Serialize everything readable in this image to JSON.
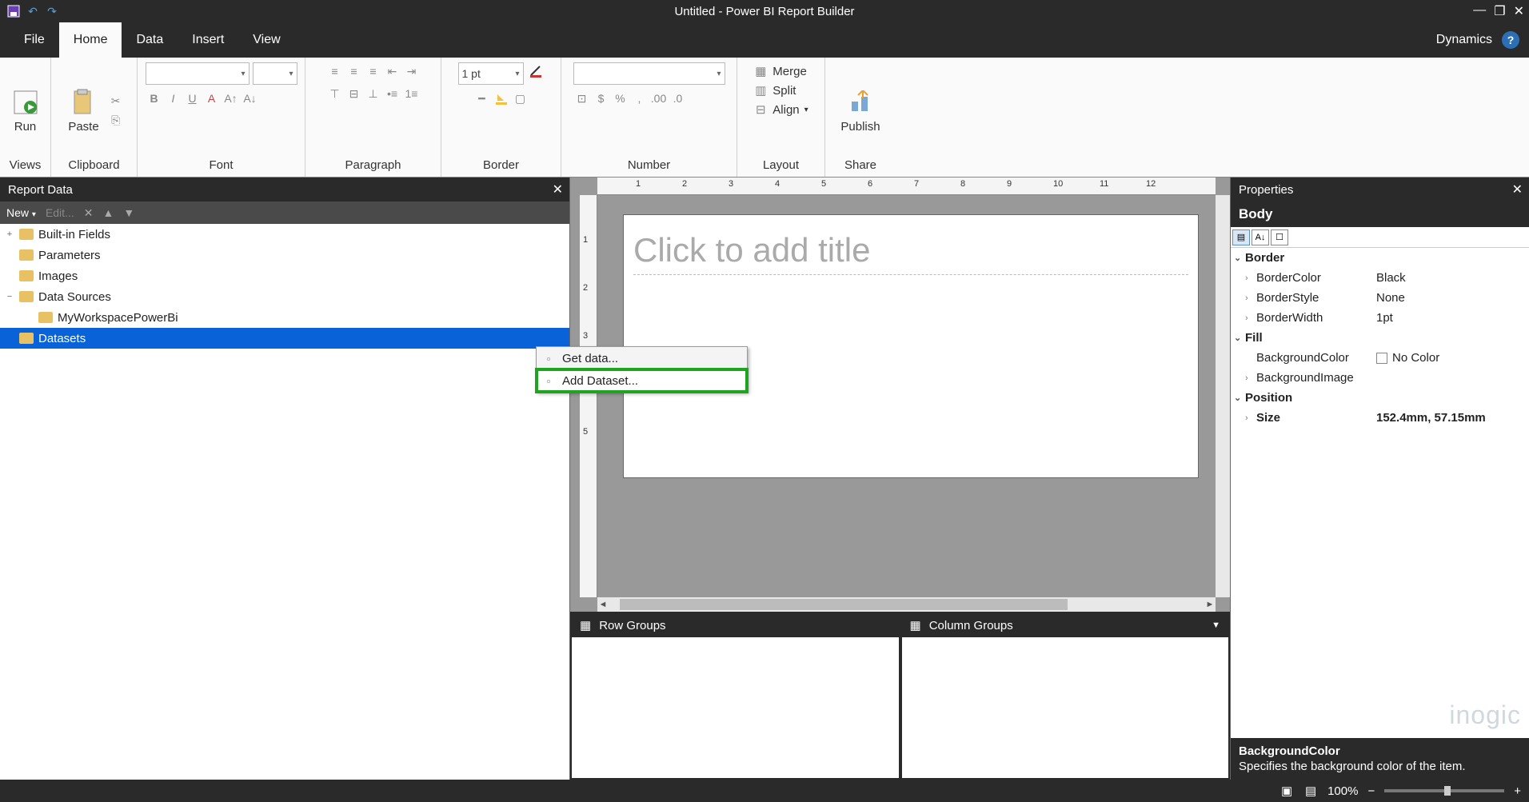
{
  "title": "Untitled - Power BI Report Builder",
  "menubar": {
    "tabs": [
      "File",
      "Home",
      "Data",
      "Insert",
      "View"
    ],
    "active": "Home",
    "right_link": "Dynamics"
  },
  "ribbon": {
    "views": {
      "label": "Views",
      "run": "Run"
    },
    "clipboard": {
      "label": "Clipboard",
      "paste": "Paste"
    },
    "font": {
      "label": "Font"
    },
    "paragraph": {
      "label": "Paragraph"
    },
    "border": {
      "label": "Border",
      "width": "1 pt"
    },
    "number": {
      "label": "Number"
    },
    "layout": {
      "label": "Layout",
      "merge": "Merge",
      "split": "Split",
      "align": "Align"
    },
    "share": {
      "label": "Share",
      "publish": "Publish"
    }
  },
  "report_data": {
    "header": "Report Data",
    "toolbar": {
      "new": "New",
      "edit": "Edit..."
    },
    "tree": [
      {
        "label": "Built-in Fields",
        "indent": 0,
        "expander": "+",
        "selected": false
      },
      {
        "label": "Parameters",
        "indent": 0,
        "expander": "",
        "selected": false
      },
      {
        "label": "Images",
        "indent": 0,
        "expander": "",
        "selected": false
      },
      {
        "label": "Data Sources",
        "indent": 0,
        "expander": "−",
        "selected": false
      },
      {
        "label": "MyWorkspacePowerBi",
        "indent": 1,
        "expander": "",
        "selected": false
      },
      {
        "label": "Datasets",
        "indent": 0,
        "expander": "",
        "selected": true
      }
    ]
  },
  "context_menu": {
    "items": [
      {
        "label": "Get data...",
        "highlight": false
      },
      {
        "label": "Add Dataset...",
        "highlight": true
      }
    ]
  },
  "design": {
    "title_placeholder": "Click to add title",
    "ruler_marks": [
      "1",
      "2",
      "3",
      "4",
      "5",
      "6",
      "7",
      "8",
      "9",
      "10",
      "11",
      "12"
    ]
  },
  "groups": {
    "row": "Row Groups",
    "col": "Column Groups"
  },
  "properties": {
    "header": "Properties",
    "object": "Body",
    "categories": [
      {
        "name": "Border",
        "rows": [
          {
            "key": "BorderColor",
            "val": "Black",
            "exp": "›"
          },
          {
            "key": "BorderStyle",
            "val": "None",
            "exp": "›"
          },
          {
            "key": "BorderWidth",
            "val": "1pt",
            "exp": "›"
          }
        ]
      },
      {
        "name": "Fill",
        "rows": [
          {
            "key": "BackgroundColor",
            "val": "No Color",
            "swatch": true
          },
          {
            "key": "BackgroundImage",
            "val": "",
            "exp": "›"
          }
        ]
      },
      {
        "name": "Position",
        "rows": [
          {
            "key": "Size",
            "val": "152.4mm, 57.15mm",
            "exp": "›",
            "bold": true
          }
        ]
      }
    ],
    "desc_title": "BackgroundColor",
    "desc_text": "Specifies the background color of the item."
  },
  "watermark": "inogic",
  "statusbar": {
    "zoom": "100%"
  }
}
